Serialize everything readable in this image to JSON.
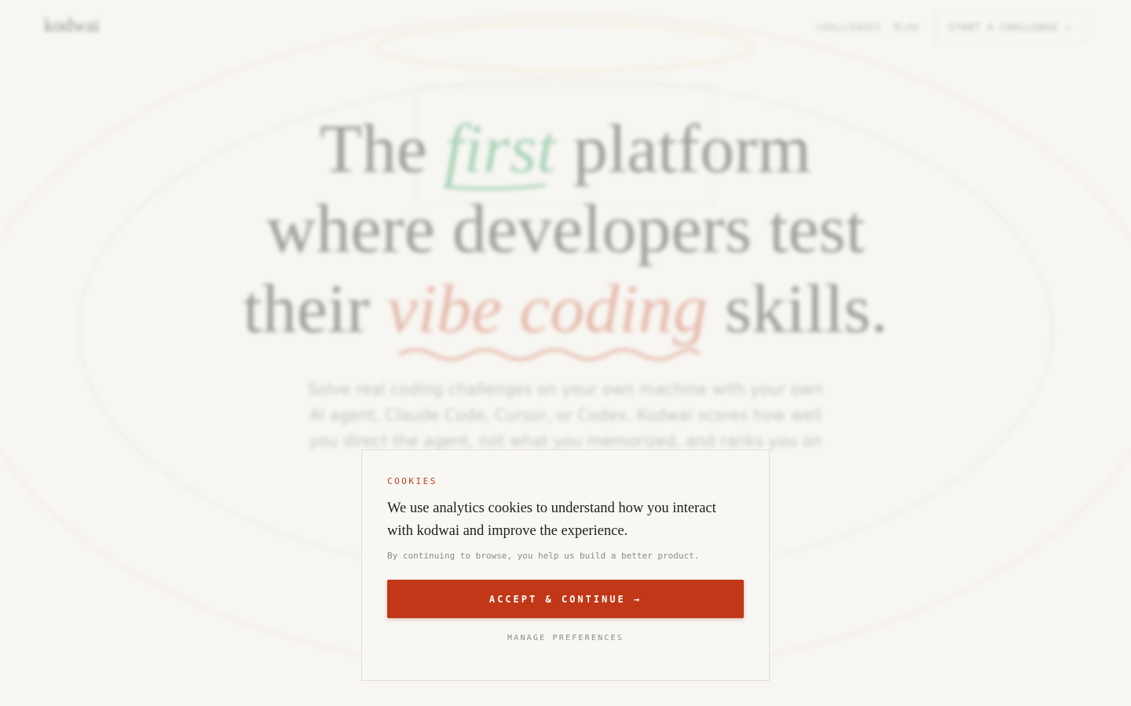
{
  "nav": {
    "logo": "kodwai",
    "links": [
      "CHALLENGES",
      "BLOG"
    ],
    "cta_label": "START A CHALLENGE →"
  },
  "hero": {
    "line1_a": "The ",
    "line1_em": "first",
    "line1_b": " platform",
    "line2": "where developers test",
    "line3_a": "their ",
    "line3_em": "vibe coding",
    "line3_b": " skills.",
    "subtext": "Solve real coding challenges on your own machine with your own AI agent, Claude Code, Cursor, or Codex. Kodwai scores how well you direct the agent, not what you memorized, and ranks you on a"
  },
  "cookie_modal": {
    "kicker": "COOKIES",
    "body": "We use analytics cookies to understand how you interact with kodwai and improve the experience.",
    "note": "By continuing to browse, you help us build a better product.",
    "accept_label": "ACCEPT & CONTINUE →",
    "manage_label": "MANAGE PREFERENCES"
  },
  "colors": {
    "accent": "#c13717",
    "green_highlight": "#6ab889",
    "red_highlight": "#d98a72",
    "background": "#f7f6f2"
  }
}
